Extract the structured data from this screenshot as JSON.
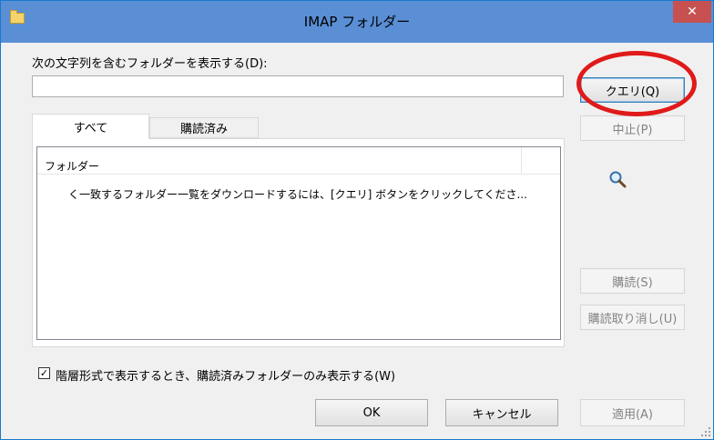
{
  "window": {
    "title": "IMAP フォルダー",
    "close_glyph": "✕"
  },
  "filter": {
    "label": "次の文字列を含むフォルダーを表示する(D):",
    "value": "",
    "placeholder": ""
  },
  "buttons": {
    "query": "クエリ(Q)",
    "stop": "中止(P)",
    "subscribe": "購読(S)",
    "unsubscribe": "購読取り消し(U)",
    "ok": "OK",
    "cancel": "キャンセル",
    "apply": "適用(A)"
  },
  "tabs": [
    {
      "label": "すべて"
    },
    {
      "label": "購読済み"
    }
  ],
  "list": {
    "column_header": "フォルダー",
    "message": "く一致するフォルダー一覧をダウンロードするには、[クエリ] ボタンをクリックしてくださ..."
  },
  "options": {
    "hierarchy_checkbox_label": "階層形式で表示するとき、購読済みフォルダーのみ表示する(W)",
    "hierarchy_checked": true,
    "check_glyph": "✓"
  },
  "icons": {
    "titlebar": "folder-icon",
    "search": "magnifier-icon"
  },
  "colors": {
    "titlebar": "#5a8fd6",
    "close": "#c75050",
    "annotation": "#e01a1a"
  }
}
